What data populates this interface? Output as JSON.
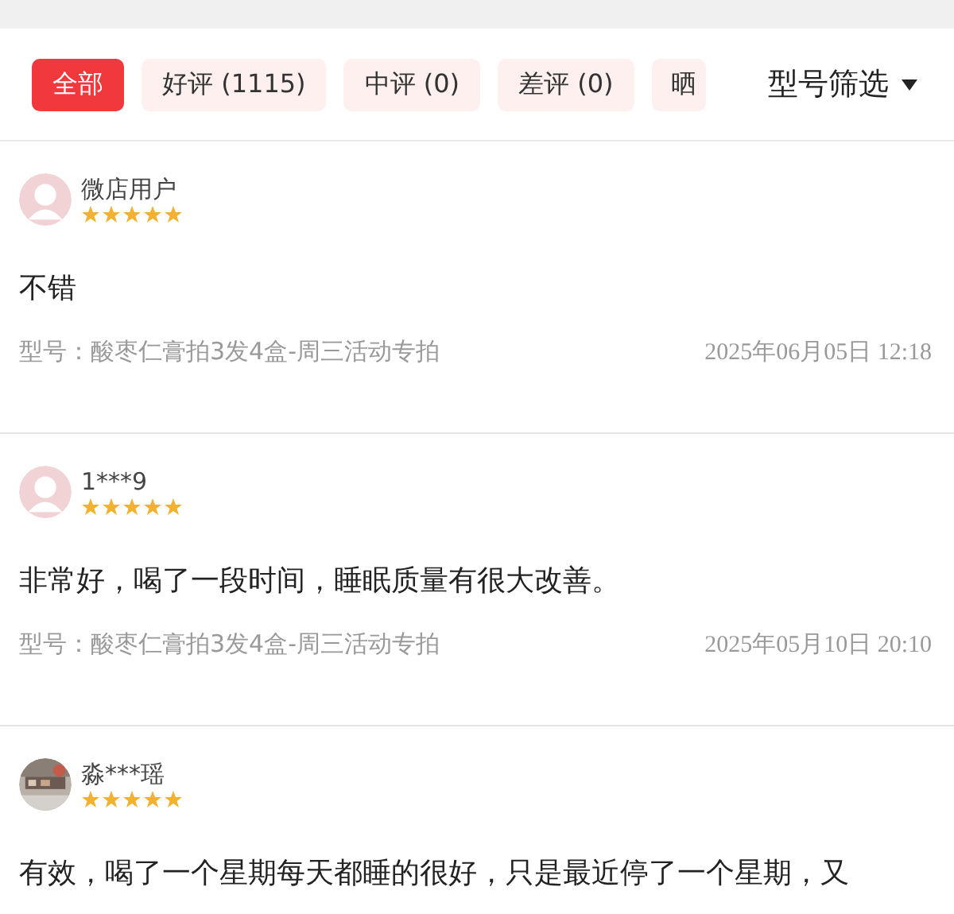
{
  "tabs": [
    {
      "label": "全部",
      "selected": true
    },
    {
      "label": "好评 (1115)",
      "selected": false
    },
    {
      "label": "中评 (0)",
      "selected": false
    },
    {
      "label": "差评 (0)",
      "selected": false
    },
    {
      "label": "晒",
      "selected": false
    }
  ],
  "filter": {
    "label": "型号筛选"
  },
  "reviews": [
    {
      "user": "微店用户",
      "avatar": {
        "kind": "default"
      },
      "stars": 5,
      "text": "不错",
      "model": "型号：酸枣仁膏拍3发4盒-周三活动专拍",
      "date": "2025年06月05日 12:18"
    },
    {
      "user": "1***9",
      "avatar": {
        "kind": "default"
      },
      "stars": 5,
      "text": "非常好，喝了一段时间，睡眠质量有很大改善。",
      "model": "型号：酸枣仁膏拍3发4盒-周三活动专拍",
      "date": "2025年05月10日 20:10"
    },
    {
      "user": "淼***瑶",
      "stars": 5,
      "text": "有效，喝了一个星期每天都睡的很好，只是最近停了一个星期，又"
    }
  ]
}
